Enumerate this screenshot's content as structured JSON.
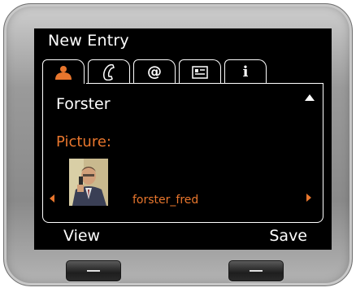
{
  "screen": {
    "title": "New Entry"
  },
  "tabs": [
    {
      "name": "person",
      "icon": "person-icon",
      "active": true
    },
    {
      "name": "phone",
      "icon": "phone-handset-icon",
      "active": false
    },
    {
      "name": "email",
      "icon_text": "@",
      "icon": "at-sign-icon",
      "active": false
    },
    {
      "name": "card",
      "icon": "business-card-icon",
      "active": false
    },
    {
      "name": "info",
      "icon_text": "i",
      "icon": "info-icon",
      "active": false
    }
  ],
  "entry": {
    "name": "Forster",
    "picture_label": "Picture:",
    "picture_file": "forster_fred"
  },
  "softkeys": {
    "left": "View",
    "right": "Save"
  },
  "colors": {
    "accent": "#e8762d",
    "screen_bg": "#000000",
    "text": "#ffffff"
  }
}
